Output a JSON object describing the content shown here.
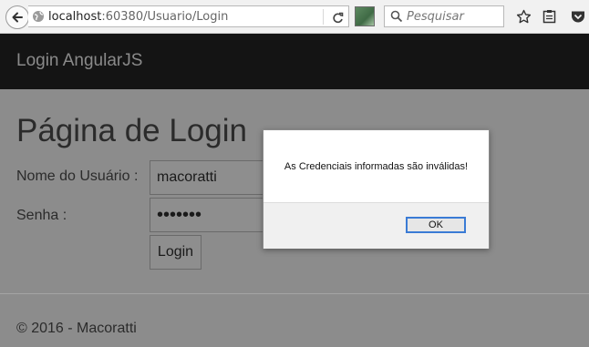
{
  "browser": {
    "url_host": "localhost",
    "url_rest": ":60380/Usuario/Login",
    "search_placeholder": "Pesquisar"
  },
  "navbar": {
    "brand": "Login AngularJS"
  },
  "page": {
    "title": "Página de Login",
    "username_label": "Nome do Usuário :",
    "username_value": "macoratti",
    "password_label": "Senha :",
    "password_value": "•••••••",
    "login_button": "Login",
    "footer": "© 2016 - Macoratti"
  },
  "dialog": {
    "message": "As Credenciais informadas são inválidas!",
    "ok_button": "OK"
  }
}
